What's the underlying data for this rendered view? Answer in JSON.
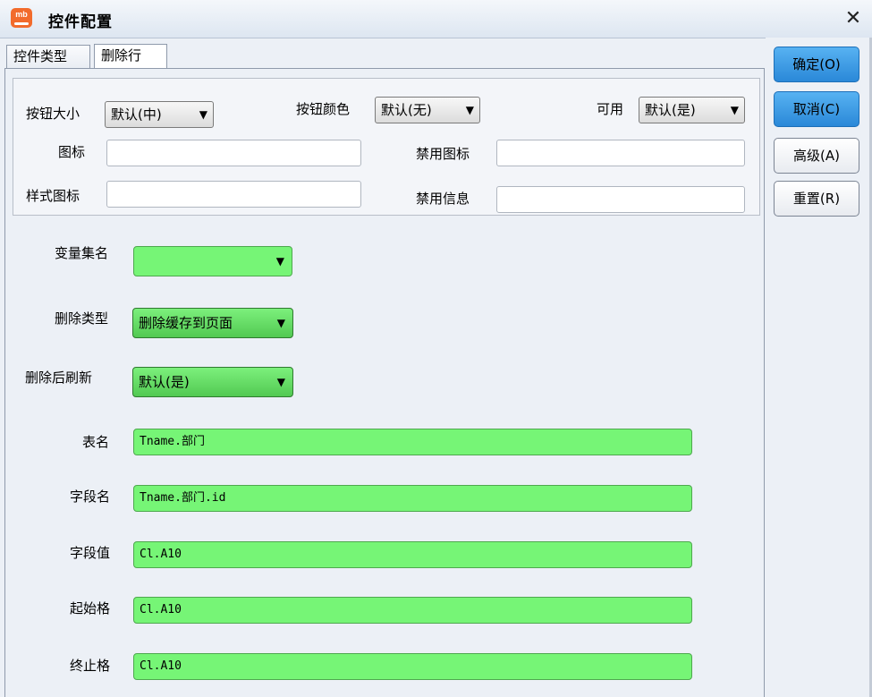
{
  "window": {
    "app_icon_text": "mb",
    "title": "控件配置",
    "close_glyph": "✕"
  },
  "tabs": [
    {
      "label": "控件类型",
      "active": false
    },
    {
      "label": "删除行",
      "active": true
    }
  ],
  "basic": {
    "size_label": "按钮大小",
    "size_value": "默认(中)",
    "color_label": "按钮颜色",
    "color_value": "默认(无)",
    "enabled_label": "可用",
    "enabled_value": "默认(是)",
    "icon_label": "图标",
    "icon_value": "",
    "disabled_icon_label": "禁用图标",
    "disabled_icon_value": "",
    "style_icon_label": "样式图标",
    "style_icon_value": "",
    "disabled_info_label": "禁用信息",
    "disabled_info_value": ""
  },
  "config": {
    "varset_label": "变量集名",
    "varset_value": "",
    "delete_type_label": "删除类型",
    "delete_type_value": "删除缓存到页面",
    "refresh_label": "删除后刷新",
    "refresh_value": "默认(是)",
    "table_label": "表名",
    "table_value": "Tname.部门",
    "field_label": "字段名",
    "field_value": "Tname.部门.id",
    "field_value_label": "字段值",
    "field_value_value": "Cl.A10",
    "start_label": "起始格",
    "start_value": "Cl.A10",
    "end_label": "终止格",
    "end_value": "Cl.A10"
  },
  "side_buttons": {
    "ok": "确定(O)",
    "cancel": "取消(C)",
    "advanced": "高级(A)",
    "reset": "重置(R)"
  },
  "colors": {
    "field_green": "#76f576",
    "button_blue": "#2a88d8",
    "accent_orange": "#f26b2c"
  }
}
